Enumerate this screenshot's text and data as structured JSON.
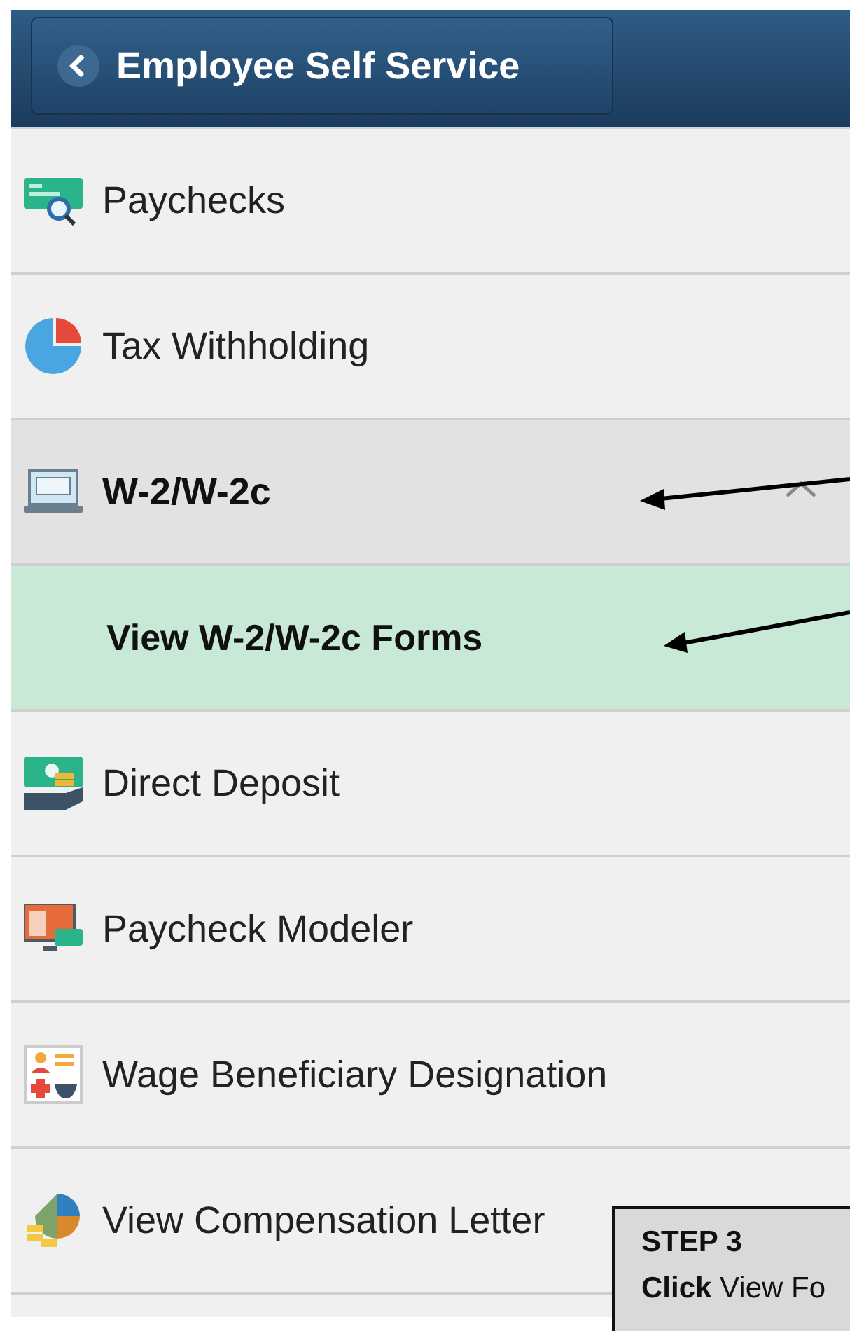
{
  "header": {
    "title": "Employee Self Service"
  },
  "menu": [
    {
      "kind": "item",
      "label": "Paychecks",
      "selected": false
    },
    {
      "kind": "item",
      "label": "Tax Withholding",
      "selected": false
    },
    {
      "kind": "group",
      "label": "W-2/W-2c",
      "expanded": true,
      "selected": false,
      "children": [
        {
          "kind": "subitem",
          "label": "View W-2/W-2c Forms",
          "selected": true
        }
      ]
    },
    {
      "kind": "item",
      "label": "Direct Deposit",
      "selected": false
    },
    {
      "kind": "item",
      "label": "Paycheck Modeler",
      "selected": false
    },
    {
      "kind": "item",
      "label": "Wage Beneficiary Designation",
      "selected": false
    },
    {
      "kind": "item",
      "label": "View Compensation Letter",
      "selected": false
    }
  ],
  "callout": {
    "title": "STEP 3",
    "text": "**Click** View Fo"
  }
}
